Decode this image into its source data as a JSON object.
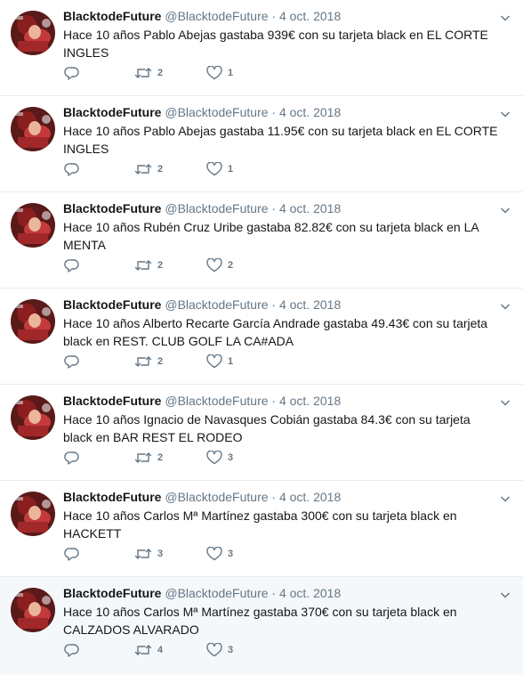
{
  "colors": {
    "text": "#14171a",
    "secondary": "#657786",
    "divider": "#e6ecf0",
    "hover_bg": "#f5f8fa"
  },
  "icons": {
    "reply": "reply-icon",
    "retweet": "retweet-icon",
    "like": "heart-icon",
    "menu": "chevron-down-icon"
  },
  "tweets": [
    {
      "name": "BlacktodeFuture",
      "handle": "@BlacktodeFuture",
      "date": "4 oct. 2018",
      "text": "Hace 10 años Pablo Abejas gastaba 939€ con su tarjeta black en EL CORTE INGLES",
      "retweets": "2",
      "likes": "1"
    },
    {
      "name": "BlacktodeFuture",
      "handle": "@BlacktodeFuture",
      "date": "4 oct. 2018",
      "text": "Hace 10 años Pablo Abejas gastaba 11.95€ con su tarjeta black en EL CORTE INGLES",
      "retweets": "2",
      "likes": "1"
    },
    {
      "name": "BlacktodeFuture",
      "handle": "@BlacktodeFuture",
      "date": "4 oct. 2018",
      "text": "Hace 10 años Rubén Cruz Uribe gastaba 82.82€ con su tarjeta black en LA MENTA",
      "retweets": "2",
      "likes": "2"
    },
    {
      "name": "BlacktodeFuture",
      "handle": "@BlacktodeFuture",
      "date": "4 oct. 2018",
      "text": "Hace 10 años Alberto Recarte García Andrade gastaba 49.43€ con su tarjeta black en REST. CLUB GOLF LA CA#ADA",
      "retweets": "2",
      "likes": "1"
    },
    {
      "name": "BlacktodeFuture",
      "handle": "@BlacktodeFuture",
      "date": "4 oct. 2018",
      "text": "Hace 10 años Ignacio de Navasques Cobián gastaba 84.3€ con su tarjeta black en BAR REST EL RODEO",
      "retweets": "2",
      "likes": "3"
    },
    {
      "name": "BlacktodeFuture",
      "handle": "@BlacktodeFuture",
      "date": "4 oct. 2018",
      "text": "Hace 10 años Carlos Mª Martínez gastaba 300€ con su tarjeta black en HACKETT",
      "retweets": "3",
      "likes": "3"
    },
    {
      "name": "BlacktodeFuture",
      "handle": "@BlacktodeFuture",
      "date": "4 oct. 2018",
      "text": "Hace 10 años Carlos Mª Martínez gastaba 370€ con su tarjeta black en CALZADOS ALVARADO",
      "retweets": "4",
      "likes": "3"
    }
  ]
}
